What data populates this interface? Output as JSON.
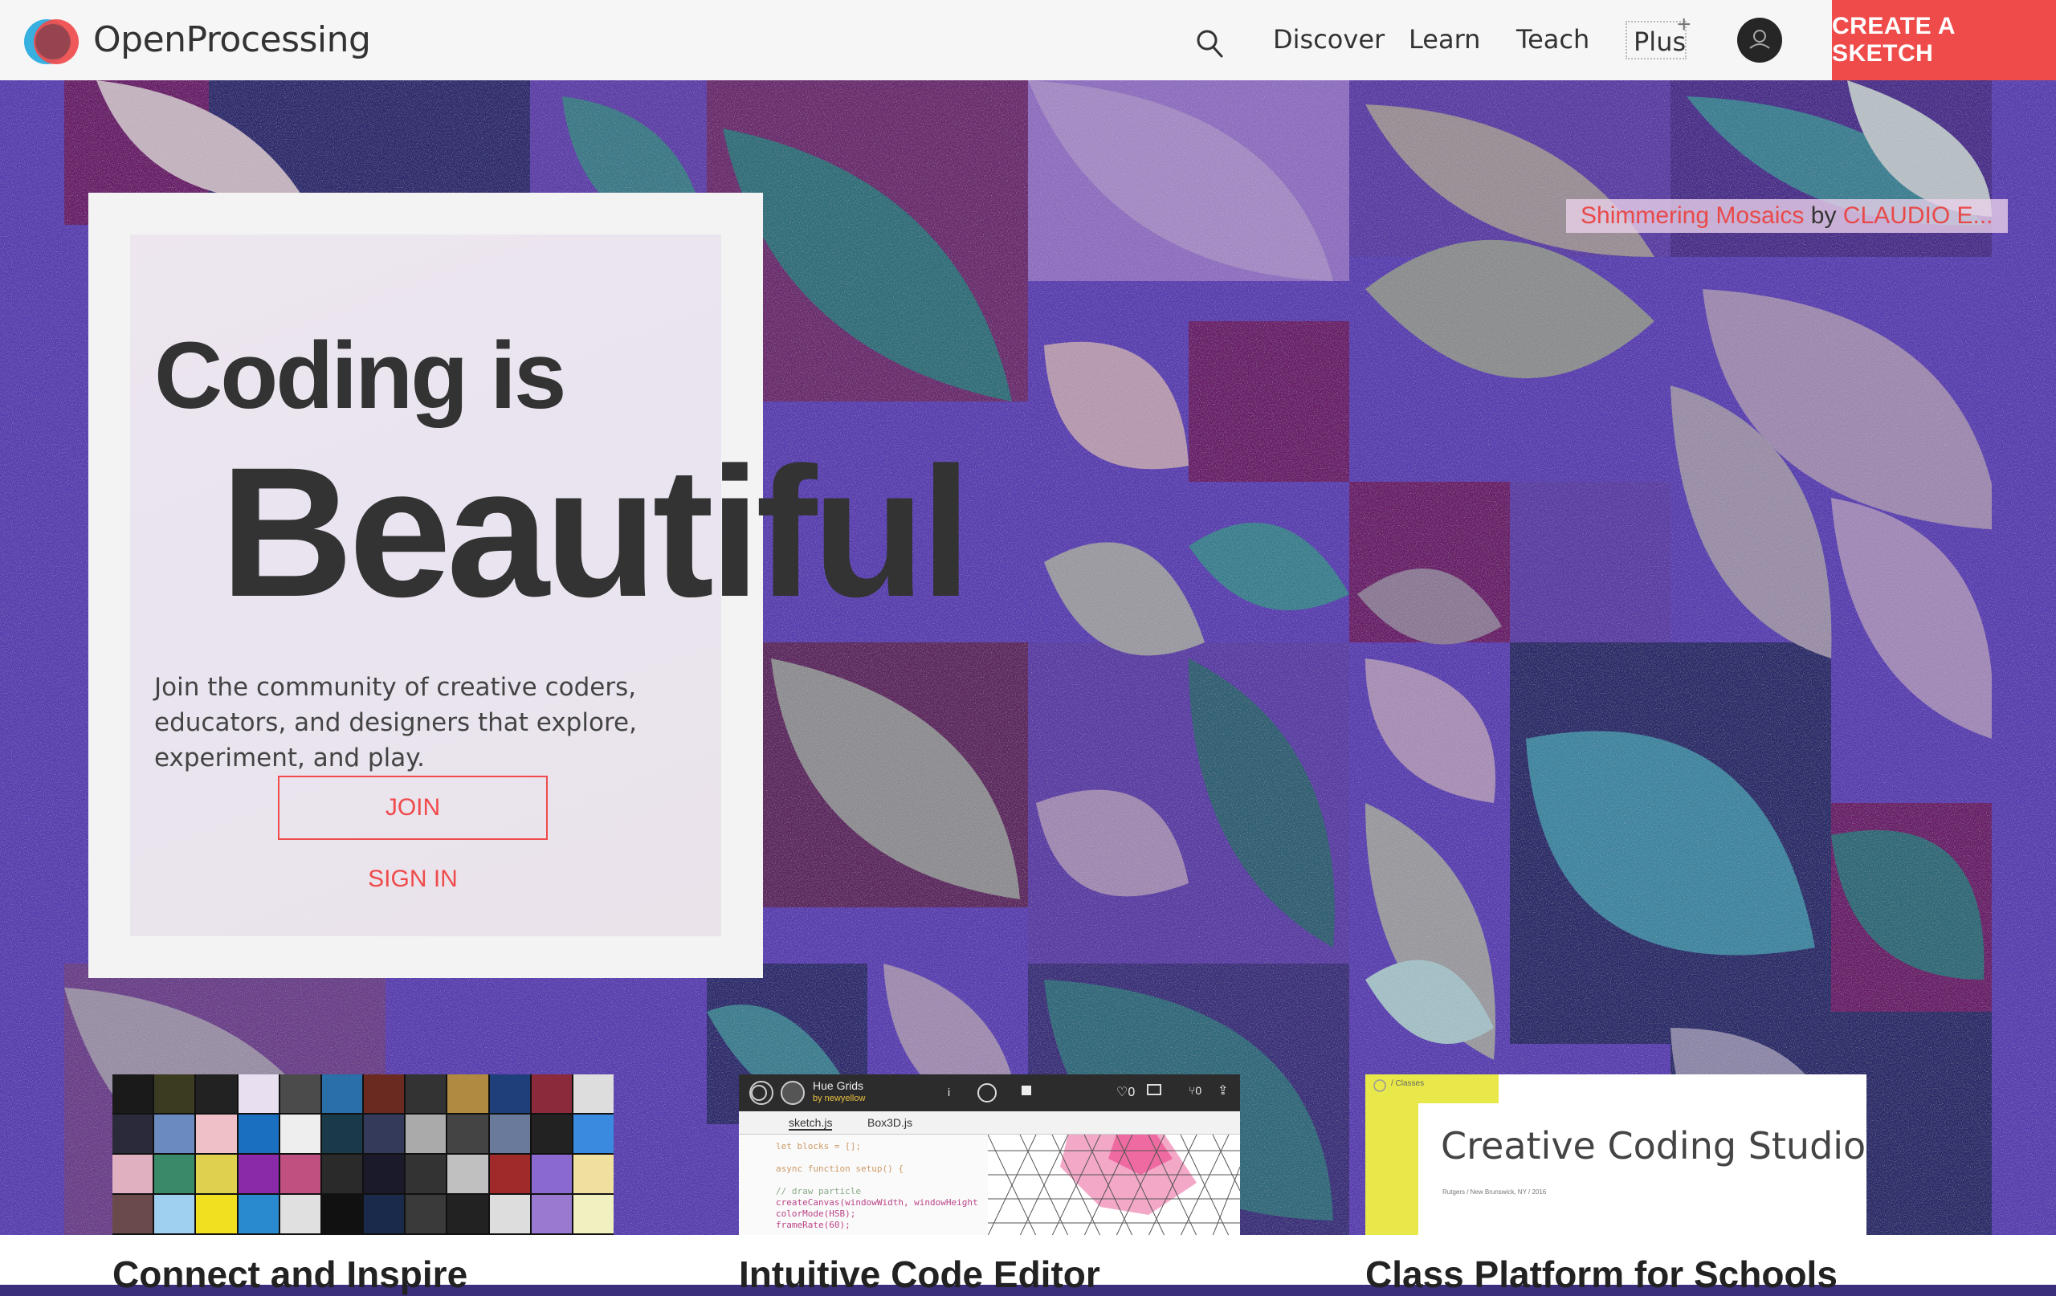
{
  "header": {
    "logo_text": "OpenProcessing",
    "nav": [
      "Discover",
      "Learn",
      "Teach"
    ],
    "plus_label": "Plus",
    "plus_mark": "+",
    "create_label": "CREATE A SKETCH"
  },
  "attribution": {
    "sketch_title": "Shimmering Mosaics",
    "by": "by",
    "author": "CLAUDIO E..."
  },
  "hero": {
    "headline_1": "Coding is",
    "headline_2": "Beautiful",
    "tagline": "Join the community of creative coders, educators, and designers that explore, experiment, and play.",
    "join_label": "JOIN",
    "signin_label": "SIGN IN"
  },
  "features": [
    {
      "title": "Connect and Inspire"
    },
    {
      "title": "Intuitive Code Editor",
      "sketch_name": "Hue Grids",
      "sketch_author": "by newyellow",
      "tabs": [
        "sketch.js",
        "Box3D.js"
      ],
      "code": [
        "let blocks = [];",
        "",
        "async function setup() {",
        "",
        "  // draw particle",
        "  createCanvas(windowWidth, windowHeight",
        "  colorMode(HSB);",
        "  frameRate(60);"
      ]
    },
    {
      "title": "Class Platform for Schools",
      "studio_title": "Creative Coding Studio",
      "studio_sub": "Rutgers / New Brunswick, NY / 2016",
      "crumb": "/ Classes"
    }
  ],
  "colors": {
    "accent": "#ef4b4b",
    "text": "#333333",
    "hero_base": "#4a3a9a"
  },
  "icons": {
    "search": "search-icon",
    "avatar": "user-avatar-icon"
  }
}
